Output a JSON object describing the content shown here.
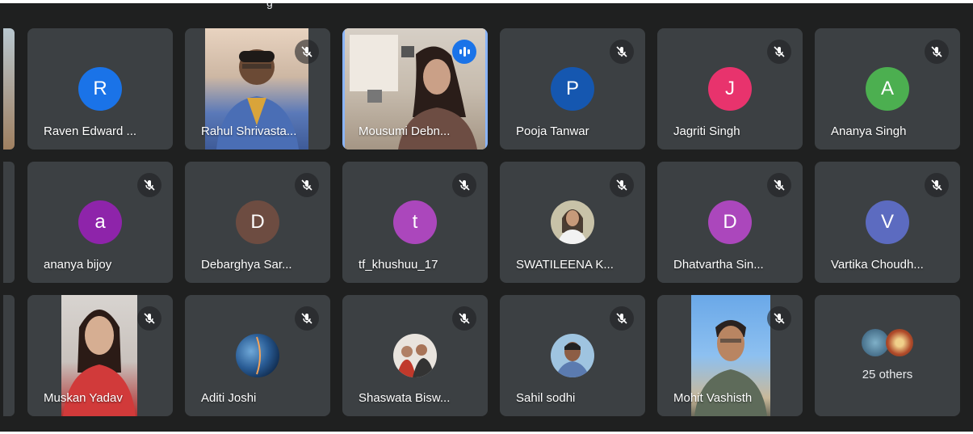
{
  "meeting": {
    "participants": [
      {
        "name": "Raven Edward ...",
        "initial": "R",
        "color": "#1a73e8",
        "muted": false
      },
      {
        "name": "Rahul Shrivasta...",
        "initial": "",
        "color": "",
        "muted": true
      },
      {
        "name": "Mousumi Debn...",
        "initial": "",
        "color": "",
        "muted": false,
        "speaking": true
      },
      {
        "name": "Pooja Tanwar",
        "initial": "P",
        "color": "#1557b0",
        "muted": true
      },
      {
        "name": "Jagriti Singh",
        "initial": "J",
        "color": "#e8336d",
        "muted": true
      },
      {
        "name": "Ananya Singh",
        "initial": "A",
        "color": "#4caf50",
        "muted": true
      },
      {
        "name": "ananya bijoy",
        "initial": "a",
        "color": "#8e24aa",
        "muted": true
      },
      {
        "name": "Debarghya Sar...",
        "initial": "D",
        "color": "#6d4c41",
        "muted": true
      },
      {
        "name": "tf_khushuu_17",
        "initial": "t",
        "color": "#ab47bc",
        "muted": true
      },
      {
        "name": "SWATILEENA K...",
        "initial": "",
        "color": "",
        "muted": true
      },
      {
        "name": "Dhatvartha Sin...",
        "initial": "D",
        "color": "#ab47bc",
        "muted": true
      },
      {
        "name": "Vartika Choudh...",
        "initial": "V",
        "color": "#5c6bc0",
        "muted": true
      },
      {
        "name": "Muskan Yadav",
        "initial": "",
        "color": "",
        "muted": true
      },
      {
        "name": "Aditi Joshi",
        "initial": "",
        "color": "",
        "muted": true
      },
      {
        "name": "Shaswata Bisw...",
        "initial": "",
        "color": "",
        "muted": true
      },
      {
        "name": "Sahil sodhi",
        "initial": "",
        "color": "",
        "muted": true
      },
      {
        "name": "Mohit Vashisth",
        "initial": "",
        "color": "",
        "muted": true
      }
    ],
    "others_label": "25 others",
    "topbar_text": "g"
  }
}
